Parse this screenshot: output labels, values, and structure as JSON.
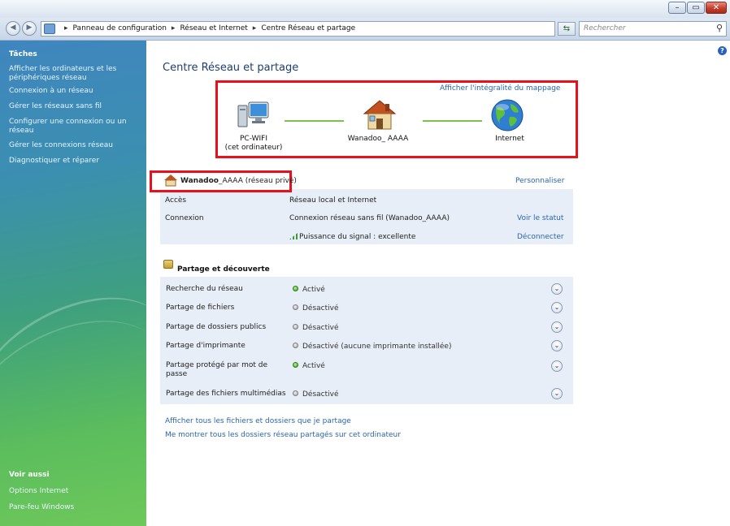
{
  "window": {
    "buttons": {
      "minimize": "–",
      "maximize": "▭",
      "close": "✕"
    }
  },
  "address": {
    "crumbs": [
      "Panneau de configuration",
      "Réseau et Internet",
      "Centre Réseau et partage"
    ],
    "search_placeholder": "Rechercher"
  },
  "sidebar": {
    "tasks_title": "Tâches",
    "tasks": [
      "Afficher les ordinateurs et les périphériques réseau",
      "Connexion à un réseau",
      "Gérer les réseaux sans fil",
      "Configurer une connexion ou un réseau",
      "Gérer les connexions réseau",
      "Diagnostiquer et réparer"
    ],
    "see_also_title": "Voir aussi",
    "see_also": [
      "Options Internet",
      "Pare-feu Windows"
    ]
  },
  "main": {
    "title": "Centre Réseau et partage",
    "map_link": "Afficher l'intégralité du mappage",
    "nodes": {
      "pc": "PC-WIFI",
      "pc_sub": "(cet ordinateur)",
      "router": "Wanadoo_ AAAA",
      "internet": "Internet"
    },
    "network": {
      "name": "Wanadoo",
      "suffix": "_AAAA (réseau privé)",
      "customize": "Personnaliser",
      "access_label": "Accès",
      "access_value": "Réseau local et Internet",
      "connection_label": "Connexion",
      "connection_value": "Connexion réseau sans fil (Wanadoo_AAAA)",
      "view_status": "Voir le statut",
      "signal": "Puissance du signal : excellente",
      "disconnect": "Déconnecter"
    },
    "sharing": {
      "title": "Partage et découverte",
      "rows": [
        {
          "label": "Recherche du réseau",
          "status": "Activé",
          "on": true
        },
        {
          "label": "Partage de fichiers",
          "status": "Désactivé",
          "on": false
        },
        {
          "label": "Partage de dossiers publics",
          "status": "Désactivé",
          "on": false
        },
        {
          "label": "Partage d'imprimante",
          "status": "Désactivé (aucune imprimante installée)",
          "on": false
        },
        {
          "label": "Partage protégé par mot de passe",
          "status": "Activé",
          "on": true
        },
        {
          "label": "Partage des fichiers multimédias",
          "status": "Désactivé",
          "on": false
        }
      ]
    },
    "links": [
      "Afficher tous les fichiers et dossiers que je partage",
      "Me montrer tous les dossiers réseau partagés sur cet ordinateur"
    ]
  }
}
